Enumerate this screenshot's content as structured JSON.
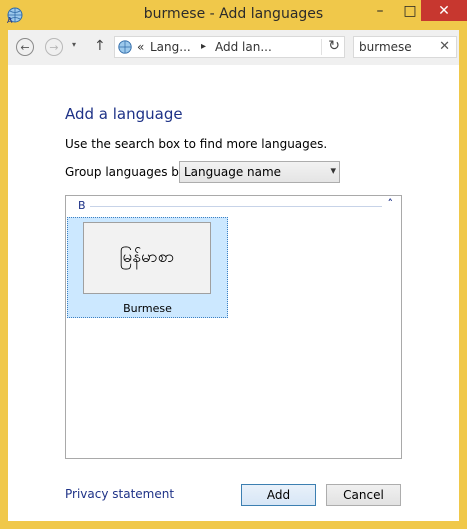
{
  "window": {
    "title": "burmese - Add languages"
  },
  "titlebar": {
    "minimize": "–",
    "maximize": "□",
    "close": "✕"
  },
  "nav": {
    "back": "←",
    "forward": "→",
    "recent": "▾",
    "up": "↑",
    "crumb_prefix": "«",
    "crumb_1": "Lang...",
    "crumb_arrow": "▸",
    "crumb_2": "Add lan...",
    "refresh": "↻",
    "search_value": "burmese",
    "search_clear": "✕"
  },
  "main": {
    "heading": "Add a language",
    "description": "Use the search box to find more languages.",
    "group_label": "Group languages by:",
    "group_value": "Language name",
    "group_arrow": "▾",
    "list": {
      "group_letter": "B",
      "collapse": "˄",
      "tiles": [
        {
          "native": "မြန်မာစာ",
          "name": "Burmese"
        }
      ]
    }
  },
  "footer": {
    "privacy": "Privacy statement",
    "add": "Add",
    "cancel": "Cancel"
  },
  "colors": {
    "frame": "#f0c84a",
    "close": "#c7372f",
    "link": "#1e3287",
    "tile_selected": "#cce8ff"
  }
}
